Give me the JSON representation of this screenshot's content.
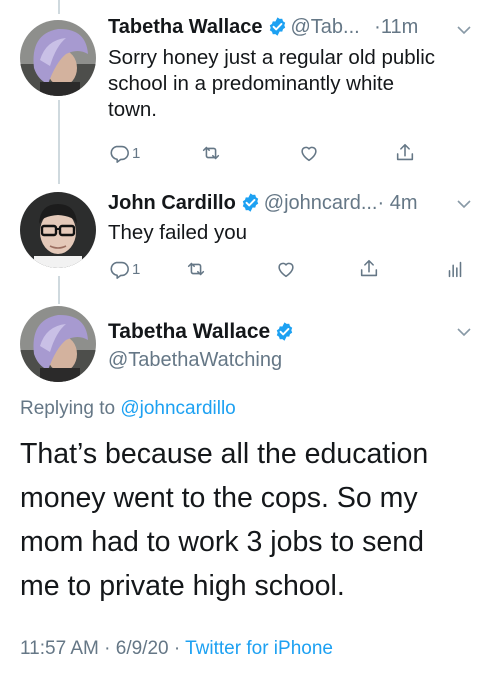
{
  "tweet1": {
    "name": "Tabetha Wallace",
    "handle": "@Tab...",
    "time": "·11m",
    "lines": [
      "Sorry honey just a regular old public",
      "school in a predominantly white",
      "town."
    ],
    "reply_count": "1"
  },
  "tweet2": {
    "name": "John Cardillo",
    "handle": "@johncard...",
    "time": "· 4m",
    "text": "They failed you",
    "reply_count": "1"
  },
  "main": {
    "name": "Tabetha Wallace",
    "handle": "@TabethaWatching",
    "replying_label": "Replying to ",
    "replying_handle": "@johncardillo",
    "lines": [
      "That’s because all the education",
      "money went to the cops. So my",
      "mom had to work 3 jobs to send",
      "me to private high school."
    ],
    "time": "11:57 AM · 6/9/20 · ",
    "source": "Twitter for iPhone"
  },
  "icons": {
    "reply": "reply-icon",
    "retweet": "retweet-icon",
    "like": "heart-icon",
    "share": "share-icon",
    "analytics": "analytics-icon",
    "verified": "verified-badge-icon",
    "more": "chevron-down-icon"
  },
  "colors": {
    "link": "#1da1f2",
    "secondary_text": "#657786",
    "verified": "#1da1f2"
  }
}
